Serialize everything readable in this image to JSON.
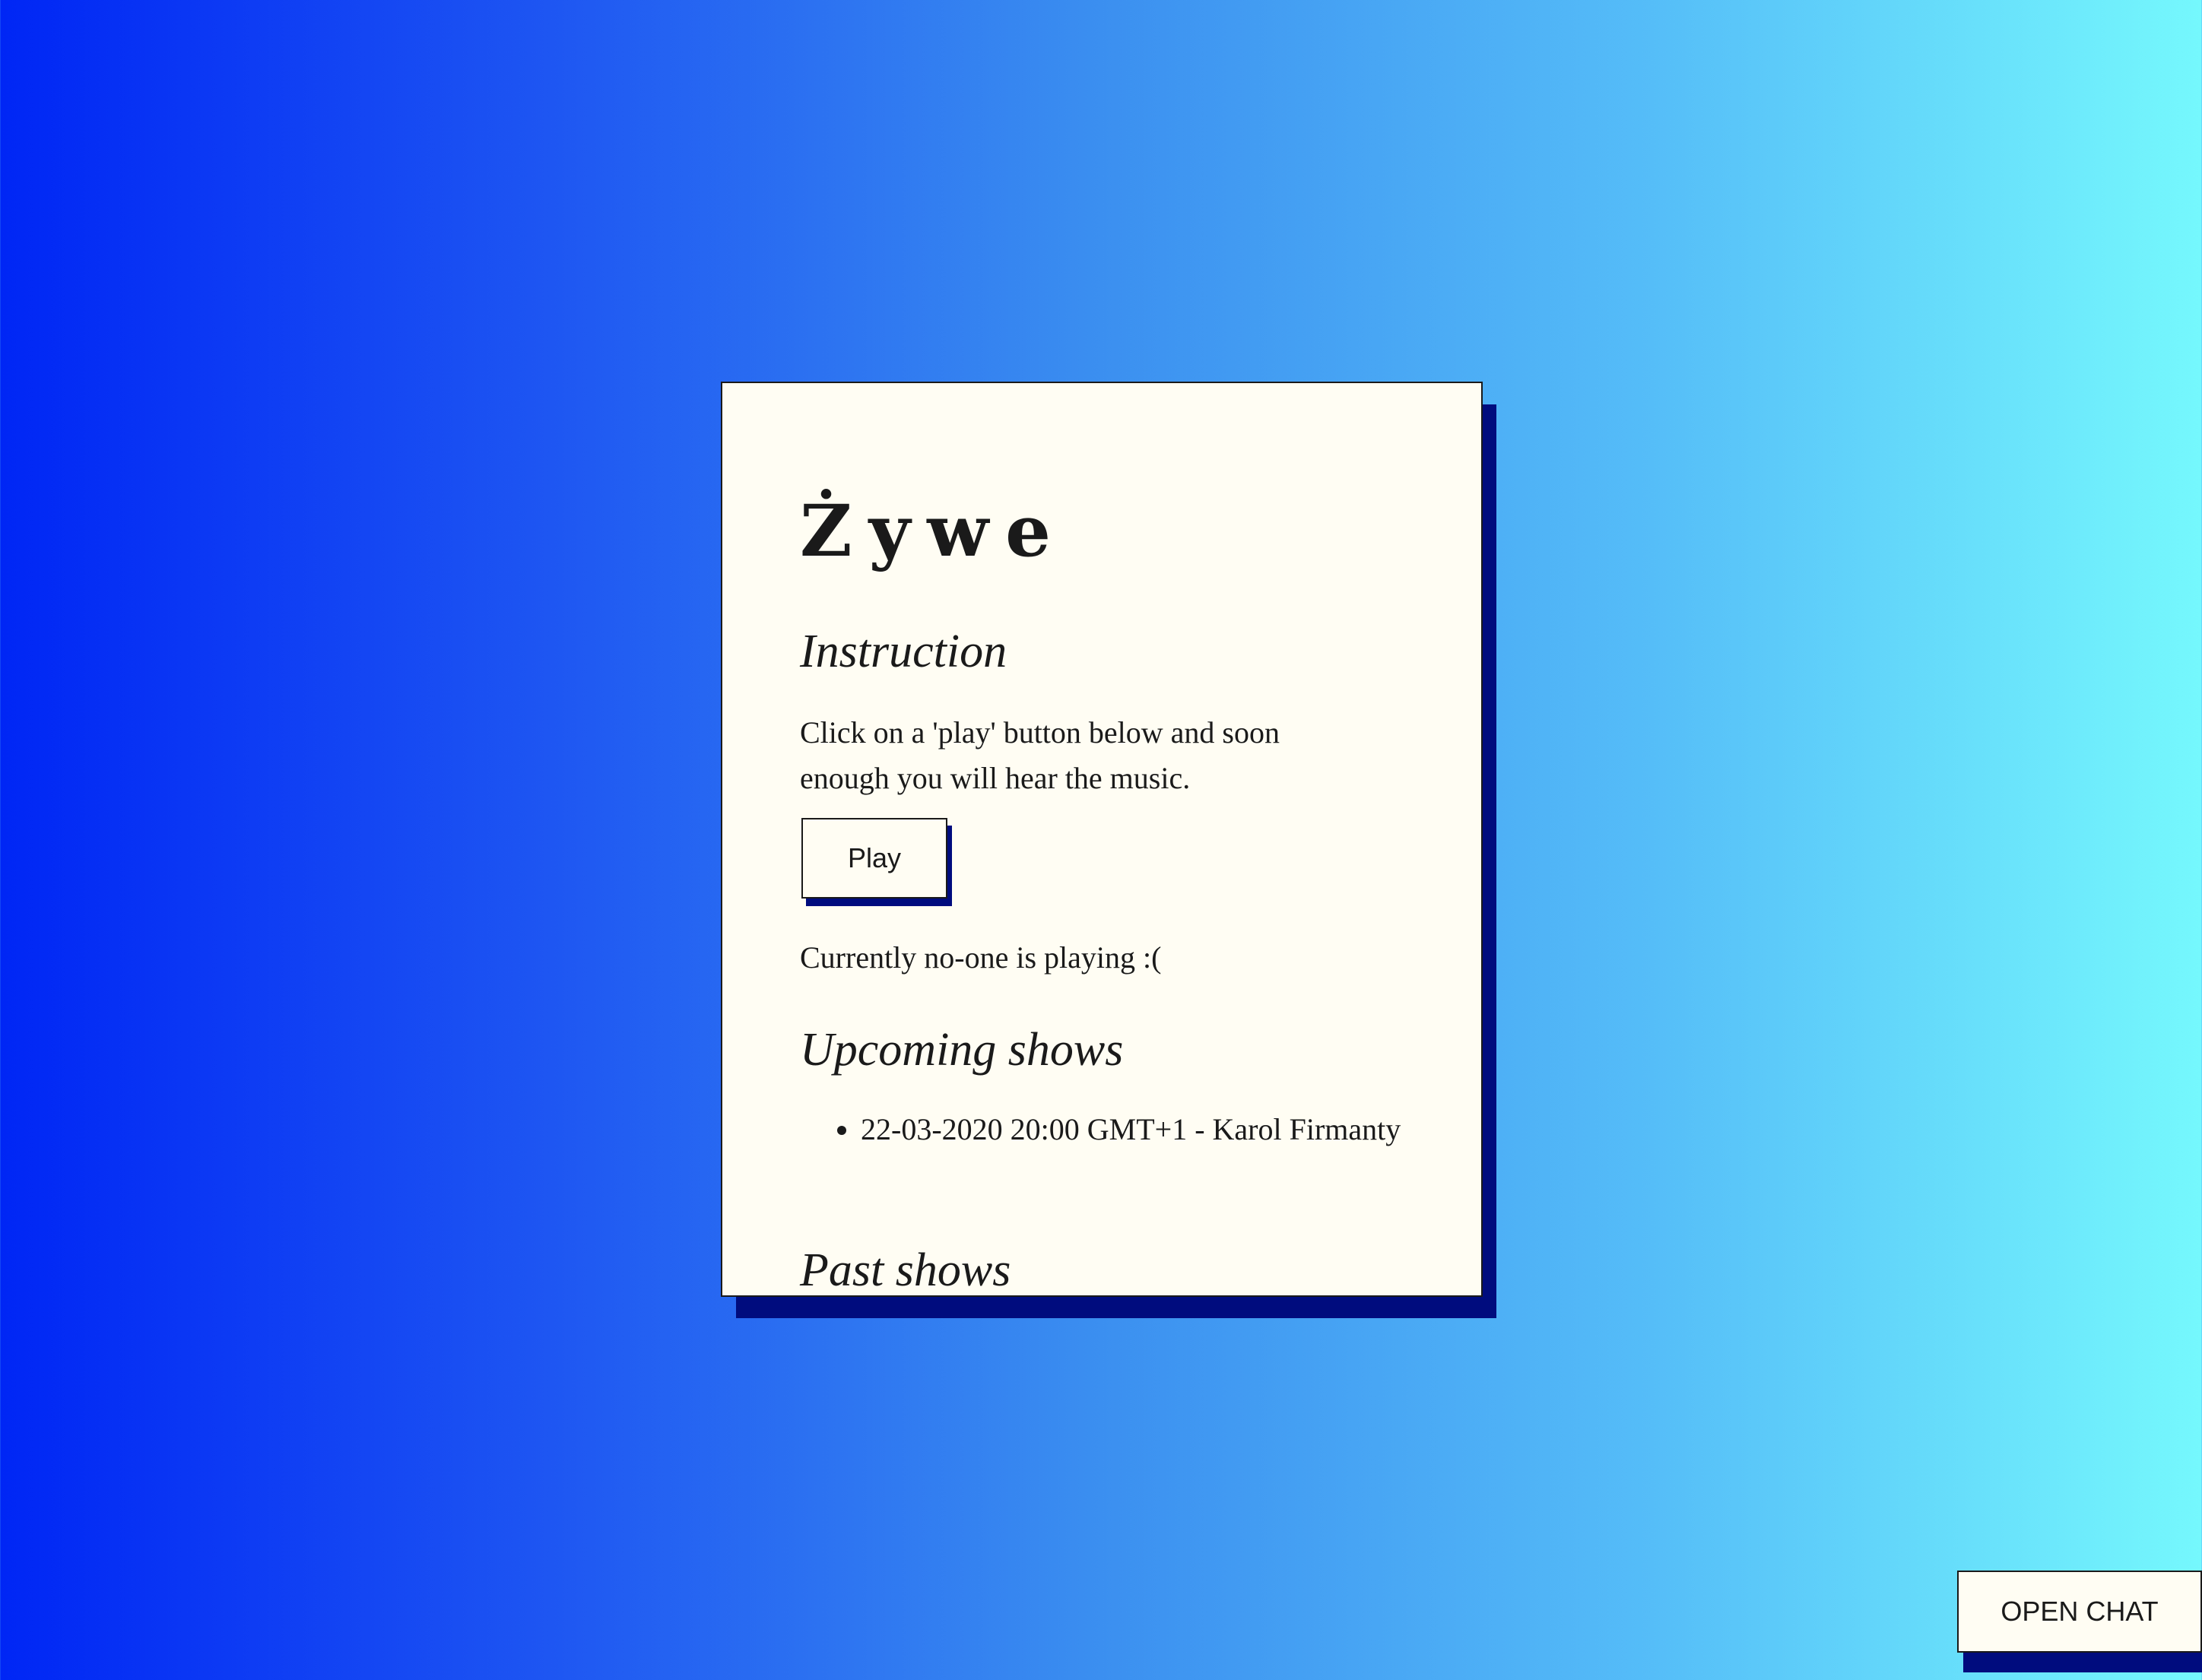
{
  "app": {
    "title": "Żywe"
  },
  "instruction": {
    "heading": "Instruction",
    "text": "Click on a 'play' button below and soon enough you will hear the music."
  },
  "player": {
    "play_label": "Play",
    "status": "Currently no-one is playing :("
  },
  "upcoming": {
    "heading": "Upcoming shows",
    "items": [
      {
        "label": "22-03-2020 20:00 GMT+1 - Karol Firmanty"
      }
    ]
  },
  "past": {
    "heading": "Past shows"
  },
  "chat": {
    "open_label": "OPEN CHAT"
  },
  "colors": {
    "gradient_start": "#0026f5",
    "gradient_end": "#75f8fd",
    "card_background": "#fffdf3",
    "shadow": "#000c7e",
    "text": "#1a1a1a"
  }
}
